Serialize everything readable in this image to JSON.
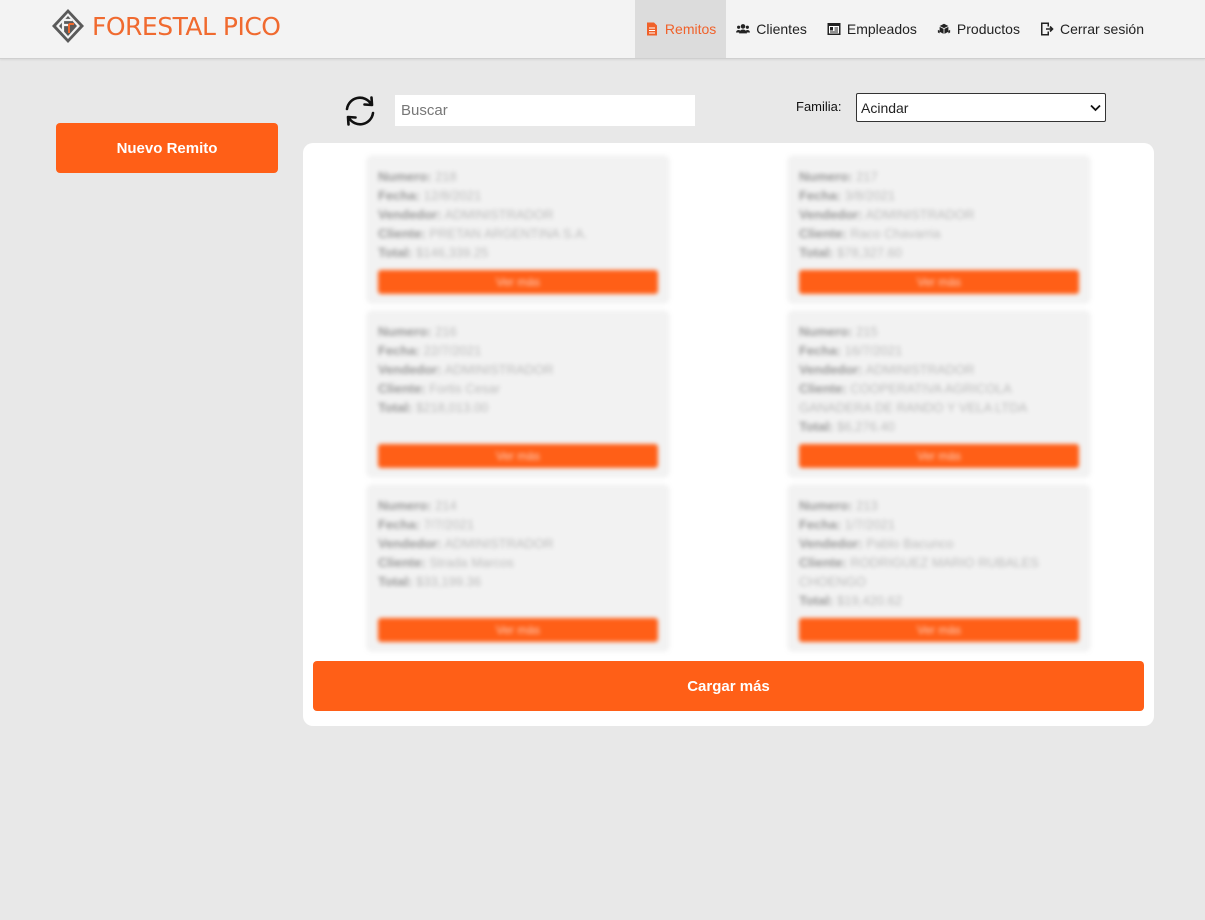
{
  "brand": {
    "name": "FORESTAL PICO",
    "color": "#f06a2f",
    "icon": "forestal-logo-icon"
  },
  "nav": {
    "items": [
      {
        "label": "Remitos",
        "icon": "document-icon",
        "active": true
      },
      {
        "label": "Clientes",
        "icon": "users-icon",
        "active": false
      },
      {
        "label": "Empleados",
        "icon": "id-card-icon",
        "active": false
      },
      {
        "label": "Productos",
        "icon": "boxes-icon",
        "active": false
      },
      {
        "label": "Cerrar sesión",
        "icon": "logout-icon",
        "active": false
      }
    ]
  },
  "sidebar": {
    "new_button": "Nuevo Remito"
  },
  "toolbar": {
    "refresh_icon": "refresh-icon",
    "search_placeholder": "Buscar",
    "search_value": "",
    "familia_label": "Familia:",
    "familia_selected": "Acindar"
  },
  "remitos": [
    {
      "numero": "218",
      "fecha": "12/8/2021",
      "vendedor": "ADMINISTRADOR",
      "cliente": "PRETAN ARGENTINA S.A.",
      "total": "$146,339.25",
      "button": "Ver más"
    },
    {
      "numero": "217",
      "fecha": "3/8/2021",
      "vendedor": "ADMINISTRADOR",
      "cliente": "Raco Chavarria",
      "total": "$78,327.60",
      "button": "Ver más"
    },
    {
      "numero": "216",
      "fecha": "22/7/2021",
      "vendedor": "ADMINISTRADOR",
      "cliente": "Fortis Cesar",
      "total": "$218,013.00",
      "button": "Ver más"
    },
    {
      "numero": "215",
      "fecha": "16/7/2021",
      "vendedor": "ADMINISTRADOR",
      "cliente": "COOPERATIVA AGRICOLA GANADERA DE RANDO Y VELA LTDA",
      "total": "$6,276.40",
      "button": "Ver más"
    },
    {
      "numero": "214",
      "fecha": "7/7/2021",
      "vendedor": "ADMINISTRADOR",
      "cliente": "Strada Marcos",
      "total": "$33,199.36",
      "button": "Ver más"
    },
    {
      "numero": "213",
      "fecha": "1/7/2021",
      "vendedor": "Pablo Bacunco",
      "cliente": "RODRIGUEZ MARIO RUBALES CHOENGO",
      "total": "$19,420.62",
      "button": "Ver más"
    }
  ],
  "field_labels": {
    "numero": "Numero:",
    "fecha": "Fecha:",
    "vendedor": "Vendedor:",
    "cliente": "Cliente:",
    "total": "Total:"
  },
  "load_more": "Cargar más",
  "colors": {
    "accent": "#ff5f17",
    "background": "#e8e8e8",
    "nav_active_bg": "#dcdcdc"
  }
}
